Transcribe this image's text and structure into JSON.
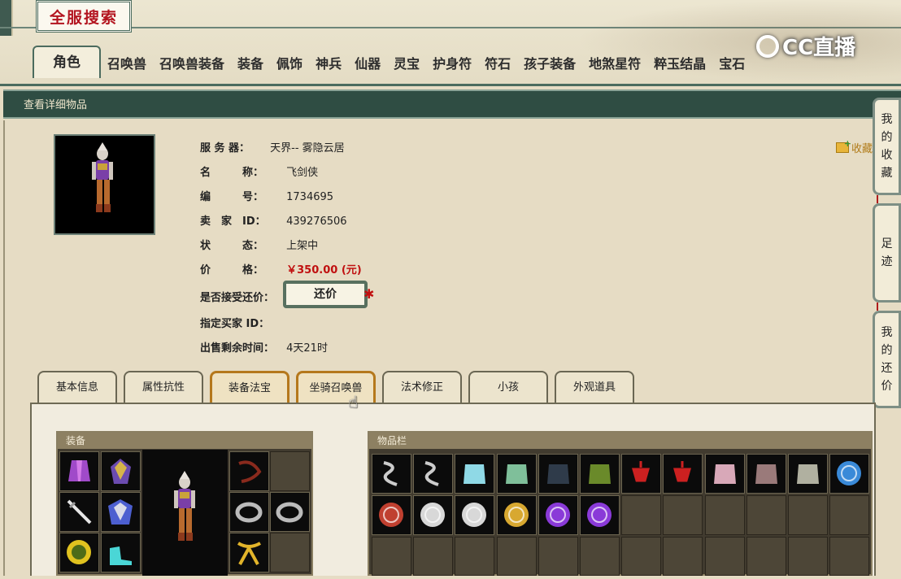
{
  "header": {
    "title": "全服搜索",
    "watermark": "CC直播",
    "tabs": [
      "角色",
      "召唤兽",
      "召唤兽装备",
      "装备",
      "佩饰",
      "神兵",
      "仙器",
      "灵宝",
      "护身符",
      "符石",
      "孩子装备",
      "地煞星符",
      "粹玉结晶",
      "宝石"
    ],
    "active_tab": "角色"
  },
  "section_title": "查看详细物品",
  "favorite_label": "收藏",
  "item": {
    "server_label": "服 务 器：",
    "server": "天界-- 雾隐云居",
    "name_label": "名　　　称：",
    "name": "飞剑侠",
    "id_label": "编　　　号：",
    "id": "1734695",
    "seller_label": "卖　家　ID：",
    "seller": "439276506",
    "status_label": "状　　　态：",
    "status": "上架中",
    "price_label": "价　　　格：",
    "price": "￥350.00 (元)",
    "counter_label": "是否接受还价：",
    "counter_button": "还价",
    "buyer_label": "指定买家 ID：",
    "buyer": "",
    "remaining_label": "出售剩余时间：",
    "remaining": "4天21时"
  },
  "side_tabs": [
    "我的收藏",
    "足迹",
    "我的还价"
  ],
  "sub_tabs": [
    "基本信息",
    "属性抗性",
    "装备法宝",
    "坐骑召唤兽",
    "法术修正",
    "小孩",
    "外观道具"
  ],
  "equipment_title": "装备",
  "inventory_title": "物品栏",
  "colors": {
    "accent": "#2f4d43",
    "price": "#c01010",
    "title_red": "#b3141f"
  }
}
